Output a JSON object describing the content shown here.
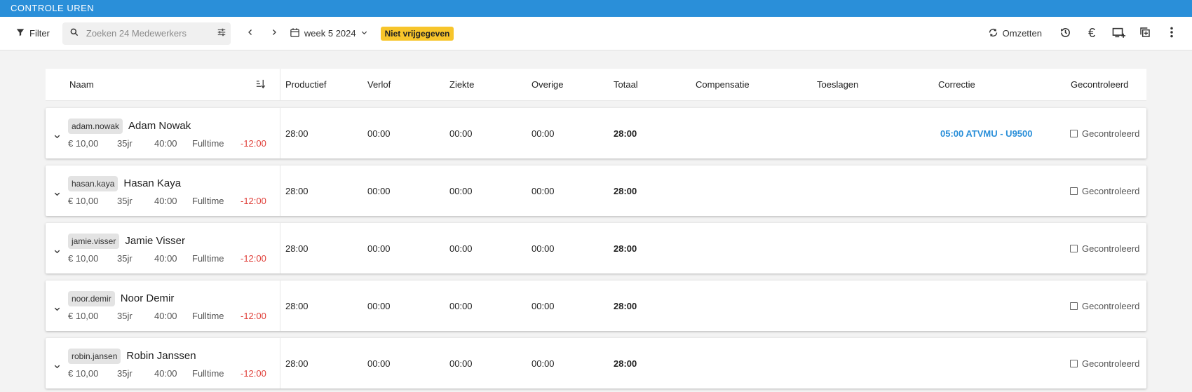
{
  "window": {
    "title": "CONTROLE UREN"
  },
  "toolbar": {
    "filter_label": "Filter",
    "search_placeholder": "Zoeken 24 Medewerkers",
    "week_label": "week 5 2024",
    "status_badge": "Niet vrijgegeven",
    "omzetten_label": "Omzetten",
    "icons": [
      "filter-icon",
      "search-icon",
      "tune-icon",
      "chevron-left-icon",
      "chevron-right-icon",
      "calendar-icon",
      "sync-icon",
      "history-icon",
      "euro-icon",
      "add-screen-icon",
      "copy-add-icon",
      "more-vert-icon"
    ]
  },
  "table": {
    "headers": {
      "naam": "Naam",
      "productief": "Productief",
      "verlof": "Verlof",
      "ziekte": "Ziekte",
      "overige": "Overige",
      "totaal": "Totaal",
      "compensatie": "Compensatie",
      "toeslagen": "Toeslagen",
      "correctie": "Correctie",
      "gecontroleerd": "Gecontroleerd"
    },
    "rows": [
      {
        "username": "adam.nowak",
        "name": "Adam Nowak",
        "rate": "€ 10,00",
        "age": "35jr",
        "hours": "40:00",
        "type": "Fulltime",
        "diff": "-12:00",
        "productief": "28:00",
        "verlof": "00:00",
        "ziekte": "00:00",
        "overige": "00:00",
        "totaal": "28:00",
        "compensatie": "",
        "toeslagen": "",
        "correctie": "05:00 ATVMU - U9500",
        "gecontroleerd_label": "Gecontroleerd"
      },
      {
        "username": "hasan.kaya",
        "name": "Hasan Kaya",
        "rate": "€ 10,00",
        "age": "35jr",
        "hours": "40:00",
        "type": "Fulltime",
        "diff": "-12:00",
        "productief": "28:00",
        "verlof": "00:00",
        "ziekte": "00:00",
        "overige": "00:00",
        "totaal": "28:00",
        "compensatie": "",
        "toeslagen": "",
        "correctie": "",
        "gecontroleerd_label": "Gecontroleerd"
      },
      {
        "username": "jamie.visser",
        "name": "Jamie Visser",
        "rate": "€ 10,00",
        "age": "35jr",
        "hours": "40:00",
        "type": "Fulltime",
        "diff": "-12:00",
        "productief": "28:00",
        "verlof": "00:00",
        "ziekte": "00:00",
        "overige": "00:00",
        "totaal": "28:00",
        "compensatie": "",
        "toeslagen": "",
        "correctie": "",
        "gecontroleerd_label": "Gecontroleerd"
      },
      {
        "username": "noor.demir",
        "name": "Noor Demir",
        "rate": "€ 10,00",
        "age": "35jr",
        "hours": "40:00",
        "type": "Fulltime",
        "diff": "-12:00",
        "productief": "28:00",
        "verlof": "00:00",
        "ziekte": "00:00",
        "overige": "00:00",
        "totaal": "28:00",
        "compensatie": "",
        "toeslagen": "",
        "correctie": "",
        "gecontroleerd_label": "Gecontroleerd"
      },
      {
        "username": "robin.jansen",
        "name": "Robin Janssen",
        "rate": "€ 10,00",
        "age": "35jr",
        "hours": "40:00",
        "type": "Fulltime",
        "diff": "-12:00",
        "productief": "28:00",
        "verlof": "00:00",
        "ziekte": "00:00",
        "overige": "00:00",
        "totaal": "28:00",
        "compensatie": "",
        "toeslagen": "",
        "correctie": "",
        "gecontroleerd_label": "Gecontroleerd"
      }
    ]
  },
  "colors": {
    "accent": "#2a8fd9",
    "badge": "#f7c52b",
    "negative": "#e0403a"
  }
}
